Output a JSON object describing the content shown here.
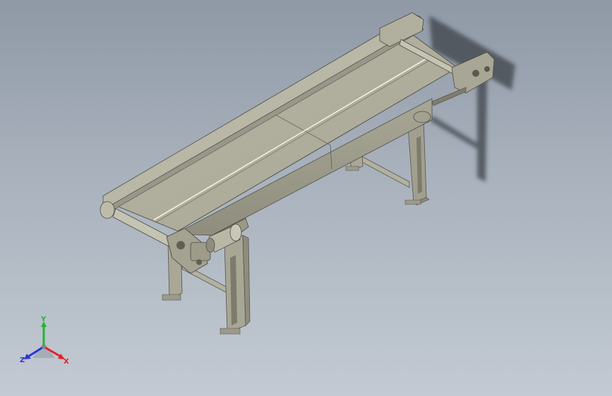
{
  "viewport": {
    "background_top": "#8f99a6",
    "background_bottom": "#c3cad3",
    "model": {
      "name": "belt-conveyor",
      "color_frame": "#b6b5a3",
      "color_belt": "#a9a795",
      "color_shadow": "#4a4f57"
    },
    "triad": {
      "x_label": "X",
      "y_label": "Y",
      "z_label": "Z",
      "x_color": "#e2202a",
      "y_color": "#1fb531",
      "z_color": "#2836d8"
    }
  }
}
